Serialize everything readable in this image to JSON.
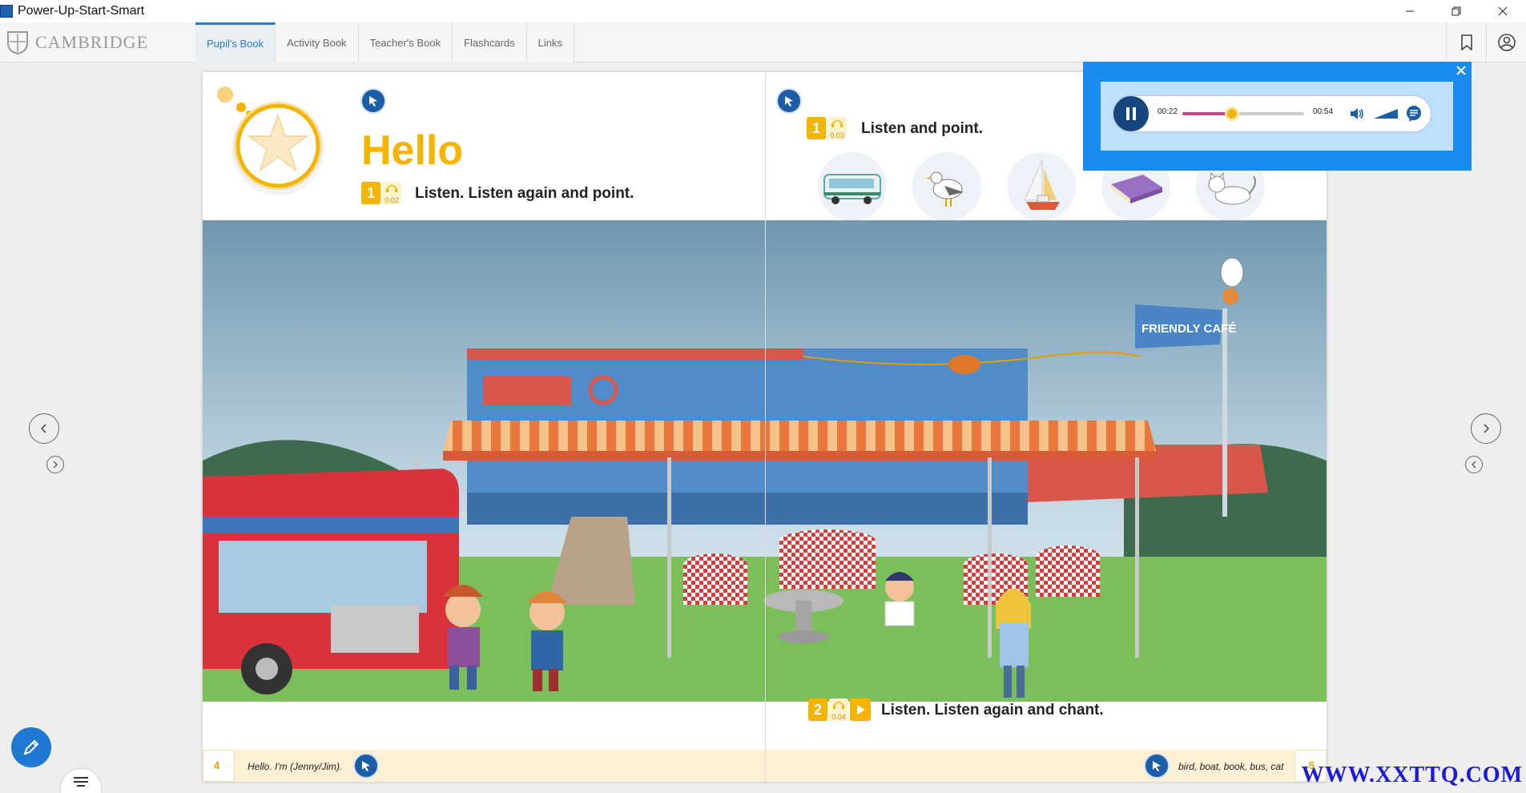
{
  "window": {
    "title": "Power-Up-Start-Smart"
  },
  "nav": {
    "logo_text": "CAMBRIDGE",
    "tabs": [
      {
        "label": "Pupil's Book",
        "active": true
      },
      {
        "label": "Activity Book",
        "active": false
      },
      {
        "label": "Teacher's Book",
        "active": false
      },
      {
        "label": "Flashcards",
        "active": false
      },
      {
        "label": "Links",
        "active": false
      }
    ]
  },
  "book": {
    "left_page": {
      "title": "Hello",
      "activity_number": "1",
      "audio_track": "0.02",
      "instruction": "Listen. Listen again and point.",
      "page_number": "4",
      "footer_text": "Hello. I'm (Jenny/Jim)."
    },
    "right_page": {
      "activity1_number": "1",
      "activity1_track": "0.03",
      "activity1_instruction": "Listen and point.",
      "activity2_number": "2",
      "activity2_track": "0.04",
      "activity2_instruction": "Listen. Listen again and chant.",
      "page_number": "5",
      "footer_text": "bird, boat, book, bus, cat"
    },
    "scene_sign": "FRIENDLY CAFÉ"
  },
  "audio_player": {
    "current_time": "00:22",
    "total_time": "00:54",
    "progress": 0.41
  },
  "colors": {
    "brand_blue": "#1a8cf0",
    "title_yellow": "#f5b400",
    "tab_active": "#2a7bc2"
  },
  "watermark": "WWW.XXTTQ.COM"
}
